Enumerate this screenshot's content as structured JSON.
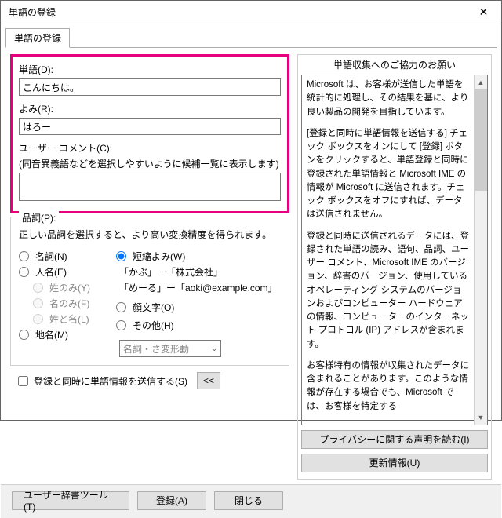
{
  "titlebar": {
    "title": "単語の登録"
  },
  "tab": {
    "label": "単語の登録"
  },
  "fields": {
    "word_label": "単語(D):",
    "word_value": "こんにちは。",
    "yomi_label": "よみ(R):",
    "yomi_value": "はろー",
    "comment_label": "ユーザー コメント(C):",
    "comment_hint": "(同音異義語などを選択しやすいように候補一覧に表示します)",
    "comment_value": ""
  },
  "hinshi": {
    "legend": "品詞(P):",
    "hint": "正しい品詞を選択すると、より高い変換精度を得られます。",
    "meishi": "名詞(N)",
    "jinmei": "人名(E)",
    "sei_nomi": "姓のみ(Y)",
    "mei_nomi": "名のみ(F)",
    "sei_mei": "姓と名(L)",
    "chimei": "地名(M)",
    "tanshuku": "短縮よみ(W)",
    "example1": "「かぶ」ー「株式会社」",
    "example2": "「めーる」ー「aoki@example.com」",
    "kaomoji": "顔文字(O)",
    "sonota": "その他(H)",
    "select_value": "名詞・さ変形動"
  },
  "checkbox": {
    "send_label": "登録と同時に単語情報を送信する(S)",
    "collapse": "<<"
  },
  "info": {
    "legend": "単語収集へのご協力のお願い",
    "p1": "Microsoft は、お客様が送信した単語を統計的に処理し、その結果を基に、より良い製品の開発を目指しています。",
    "p2": "[登録と同時に単語情報を送信する] チェック ボックスをオンにして [登録] ボタンをクリックすると、単語登録と同時に登録された単語情報と Microsoft IME の情報が Microsoft に送信されます。チェック ボックスをオフにすれば、データは送信されません。",
    "p3": "登録と同時に送信されるデータには、登録された単語の読み、語句、品詞、ユーザー コメント、Microsoft IME のバージョン、辞書のバージョン、使用しているオペレーティング システムのバージョンおよびコンピューター ハードウェアの情報、コンピューターのインターネット プロトコル (IP) アドレスが含まれます。",
    "p4": "お客様特有の情報が収集されたデータに含まれることがあります。このような情報が存在する場合でも、Microsoft では、お客様を特定する"
  },
  "right_buttons": {
    "privacy": "プライバシーに関する声明を読む(I)",
    "update": "更新情報(U)"
  },
  "bottom": {
    "dict_tool": "ユーザー辞書ツール(T)",
    "register": "登録(A)",
    "close": "閉じる"
  },
  "icons": {
    "close_glyph": "✕",
    "up": "▲",
    "down": "▼",
    "chev": "⌄"
  }
}
